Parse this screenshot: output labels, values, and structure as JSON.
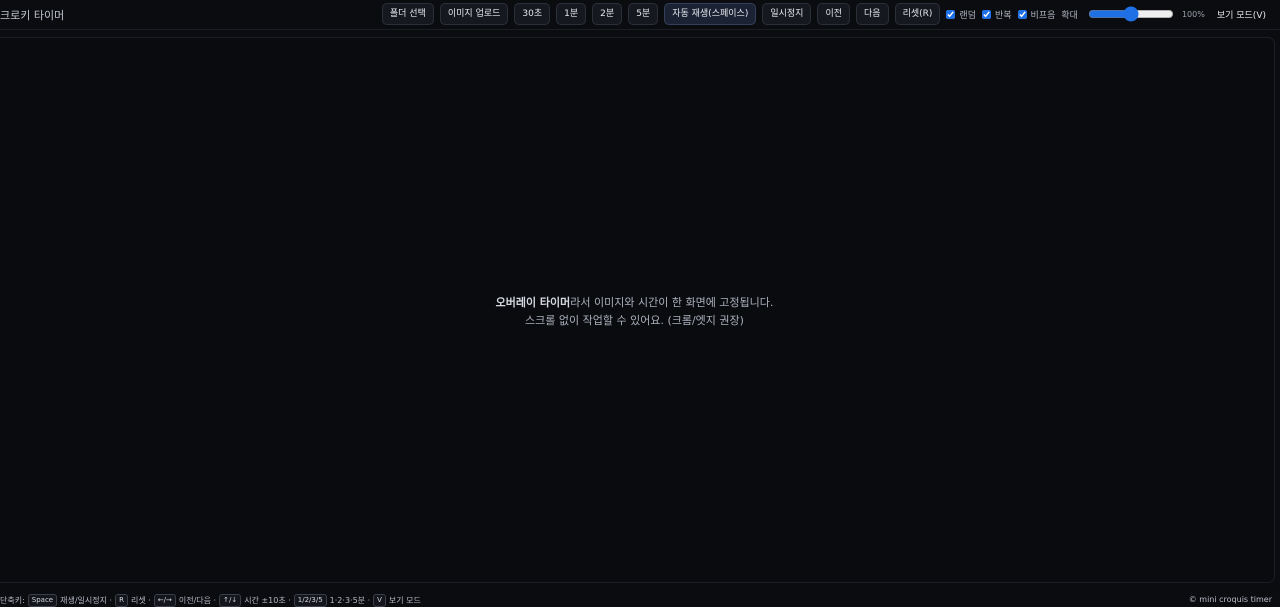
{
  "app": {
    "title": "크로키 타이머"
  },
  "toolbar": {
    "folder_label": "폴더 선택",
    "upload_label": "이미지 업로드",
    "t30_label": "30초",
    "t1_label": "1분",
    "t2_label": "2분",
    "t5_label": "5분",
    "autoplay_label": "자동 재생(스페이스)",
    "pause_label": "일시정지",
    "prev_label": "이전",
    "next_label": "다음",
    "reset_label": "리셋(R)",
    "random_label": "랜덤",
    "random_checked": true,
    "repeat_label": "반복",
    "repeat_checked": true,
    "beep_label": "비프음",
    "beep_checked": true,
    "zoom_label": "확대",
    "zoom_value": "100%",
    "zoom_level": 0.5,
    "view_mode_label": "보기 모드(V)"
  },
  "stage": {
    "message_bold": "오버레이 타이머",
    "message_line1": "라서 이미지와 시간이 한 화면에 고정됩니다.",
    "message_line2": "스크롤 없이 작업할 수 있어요. (크롬/엣지 권장)"
  },
  "footer": {
    "shortcuts_label": "단축키:",
    "space_key": "Space",
    "space_desc": "재생/일시정지 ·",
    "r_key": "R",
    "r_desc": "리셋 ·",
    "arrows_lr_key": "←/→",
    "arrows_lr_desc": "이전/다음 ·",
    "arrows_ud_key": "↑/↓",
    "arrows_ud_desc": "시간 ±10초 ·",
    "nums_key": "1/2/3/5",
    "nums_desc": "1·2·3·5분 ·",
    "v_key": "V",
    "v_desc": "보기 모드",
    "copyright": "© mini croquis timer"
  },
  "colors": {
    "background": "#0b0c10",
    "accent": "#1f6fe5",
    "button_bg": "#15181f"
  }
}
